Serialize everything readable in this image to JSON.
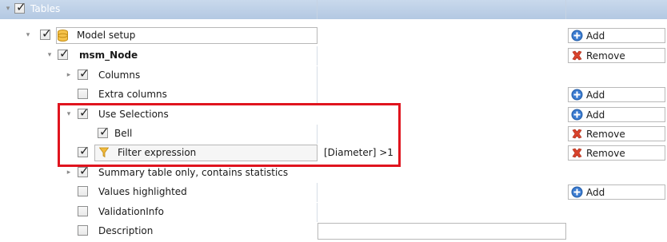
{
  "colors": {
    "header_bg": "#b7cbe4",
    "selection_border": "#e0141e",
    "add_icon": "#3b7bd0",
    "remove_icon": "#d9432c"
  },
  "tree": {
    "root_label": "Tables",
    "model_setup": {
      "label": "Model setup",
      "button": "Add"
    },
    "node": {
      "label": "msm_Node",
      "button": "Remove"
    },
    "columns": {
      "label": "Columns"
    },
    "extra_columns": {
      "label": "Extra columns",
      "button": "Add"
    },
    "use_selections": {
      "label": "Use Selections",
      "button": "Add"
    },
    "bell": {
      "label": "Bell",
      "button": "Remove"
    },
    "filter_expression": {
      "label": "Filter expression",
      "value": "[Diameter] >1",
      "button": "Remove"
    },
    "summary_table": {
      "label": "Summary table only, contains statistics"
    },
    "values_highlighted": {
      "label": "Values highlighted",
      "button": "Add"
    },
    "validation_info": {
      "label": "ValidationInfo"
    },
    "description": {
      "label": "Description"
    }
  },
  "icons": {
    "database": "database-icon",
    "filter": "funnel-icon",
    "add": "plus-circle-icon",
    "remove": "x-icon"
  }
}
